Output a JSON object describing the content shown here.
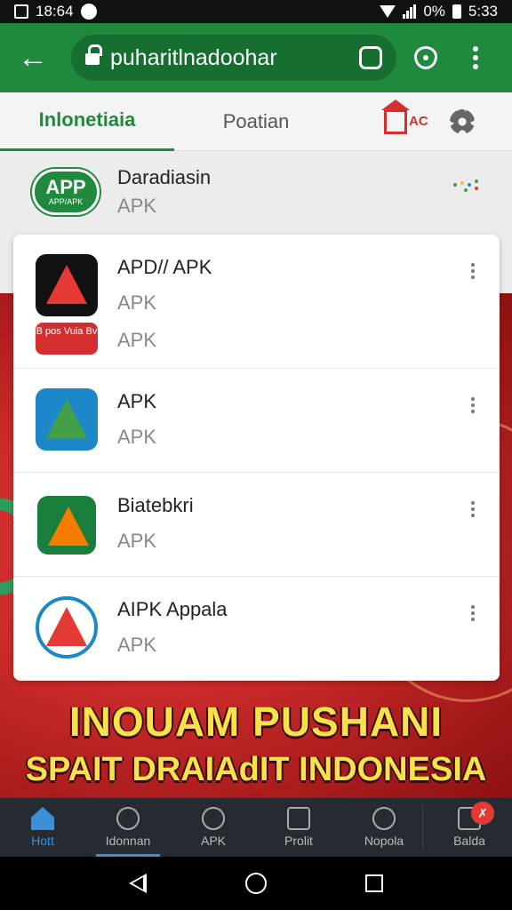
{
  "status_bar": {
    "time_left": "18:64",
    "battery": "0%",
    "time_right": "5:33"
  },
  "toolbar": {
    "url": "puharitlnadoohar"
  },
  "tabs": [
    {
      "label": "Inlonetiaia"
    },
    {
      "label": "Poatian"
    }
  ],
  "store_tag": "AC",
  "top_row": {
    "logo_big": "APP",
    "logo_small": "APP/APK",
    "title": "Daradiasin",
    "subtitle": "APK"
  },
  "apps": [
    {
      "title": "APD// APK",
      "subtitle": "APK",
      "subtitle2": "APK",
      "badge": "B pos Vuia Bv"
    },
    {
      "title": "APK",
      "subtitle": "APK"
    },
    {
      "title": "Biatebkri",
      "subtitle": "APK"
    },
    {
      "title": "AIPK Appala",
      "subtitle": "APK"
    }
  ],
  "banner": {
    "line1": "INOUAM PUSHANI",
    "line2": "SPAIT DRAIAdIT INDONESIA"
  },
  "bottom_nav": [
    {
      "label": "Hott"
    },
    {
      "label": "Idonnan"
    },
    {
      "label": "APK"
    },
    {
      "label": "Prolit"
    },
    {
      "label": "Nopola"
    },
    {
      "label": "Balda"
    }
  ],
  "colors": {
    "brand_green": "#1f8a3e",
    "banner_red": "#c62828",
    "accent_blue": "#3b8fd6"
  }
}
